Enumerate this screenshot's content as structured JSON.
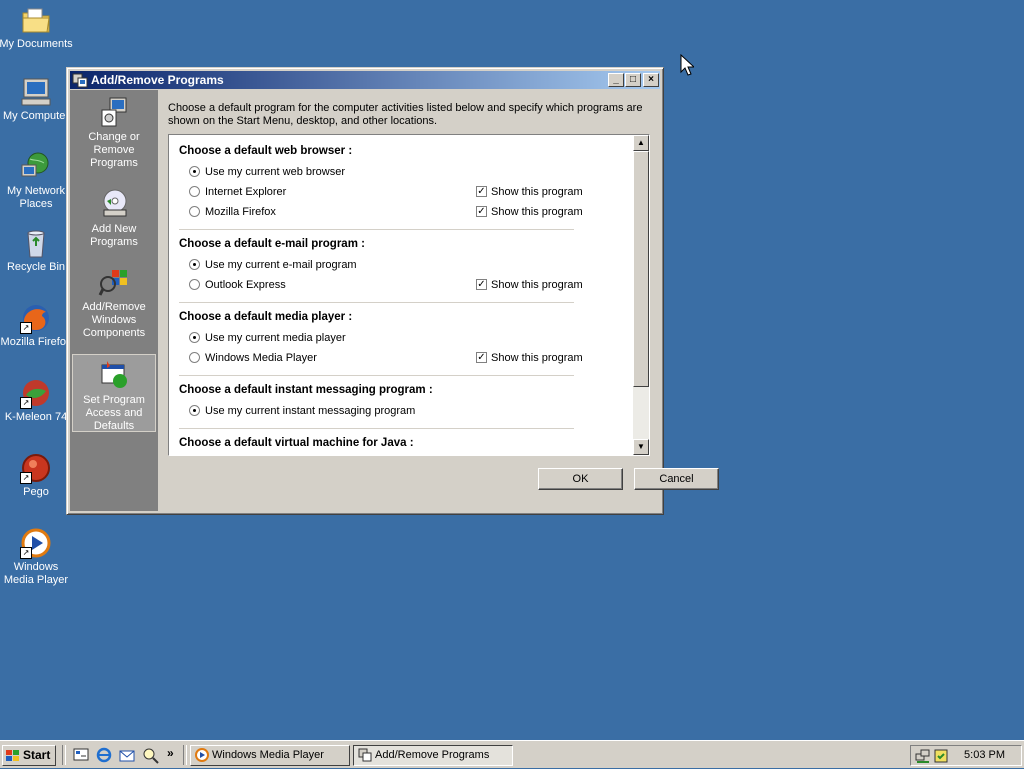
{
  "desktop": {
    "icons": [
      {
        "label": "My Documents",
        "icon": "folder-documents-icon"
      },
      {
        "label": "My Computer",
        "icon": "computer-icon"
      },
      {
        "label": "My Network Places",
        "icon": "network-icon"
      },
      {
        "label": "Recycle Bin",
        "icon": "recycle-bin-icon"
      },
      {
        "label": "Mozilla Firefox",
        "icon": "firefox-icon"
      },
      {
        "label": "K-Meleon 74",
        "icon": "kmeleon-icon"
      },
      {
        "label": "Pego",
        "icon": "pego-icon"
      },
      {
        "label": "Windows Media Player",
        "icon": "media-player-icon"
      }
    ]
  },
  "window": {
    "title": "Add/Remove Programs",
    "controls": {
      "minimize": "_",
      "maximize": "□",
      "close": "×"
    },
    "sidebar": [
      {
        "label": "Change or Remove Programs",
        "icon": "change-remove-icon"
      },
      {
        "label": "Add New Programs",
        "icon": "add-new-cd-icon"
      },
      {
        "label": "Add/Remove Windows Components",
        "icon": "windows-components-icon"
      },
      {
        "label": "Set Program Access and Defaults",
        "icon": "program-defaults-icon",
        "selected": true
      }
    ],
    "description": "Choose a default program for the computer activities listed below and specify which programs are shown on the Start Menu, desktop, and other locations.",
    "sections": {
      "browser": {
        "title": "Choose a default web browser :",
        "options": [
          {
            "label": "Use my current web browser",
            "selected": true
          },
          {
            "label": "Internet Explorer",
            "selected": false,
            "show_label": "Show this program",
            "show_checked": true
          },
          {
            "label": "Mozilla Firefox",
            "selected": false,
            "show_label": "Show this program",
            "show_checked": true
          }
        ]
      },
      "email": {
        "title": "Choose a default e-mail program :",
        "options": [
          {
            "label": "Use my current e-mail program",
            "selected": true
          },
          {
            "label": "Outlook Express",
            "selected": false,
            "show_label": "Show this program",
            "show_checked": true
          }
        ]
      },
      "media": {
        "title": "Choose a default media player :",
        "options": [
          {
            "label": "Use my current media player",
            "selected": true
          },
          {
            "label": "Windows Media Player",
            "selected": false,
            "show_label": "Show this program",
            "show_checked": true
          }
        ]
      },
      "im": {
        "title": "Choose a default instant messaging program :",
        "options": [
          {
            "label": "Use my current instant messaging program",
            "selected": true
          }
        ]
      },
      "java": {
        "title": "Choose a default virtual machine for Java :"
      }
    },
    "buttons": {
      "ok": "OK",
      "cancel": "Cancel"
    }
  },
  "taskbar": {
    "start_label": "Start",
    "quick_launch": [
      "show-desktop-icon",
      "internet-explorer-icon",
      "outlook-express-icon",
      "search-icon"
    ],
    "quick_launch_more": "»",
    "tasks": [
      {
        "label": "Windows Media Player",
        "icon": "media-player-icon",
        "active": false
      },
      {
        "label": "Add/Remove Programs",
        "icon": "add-remove-programs-icon",
        "active": true
      }
    ],
    "tray_icons": [
      "network-tray-icon",
      "security-tray-icon"
    ],
    "clock": "5:03 PM"
  }
}
